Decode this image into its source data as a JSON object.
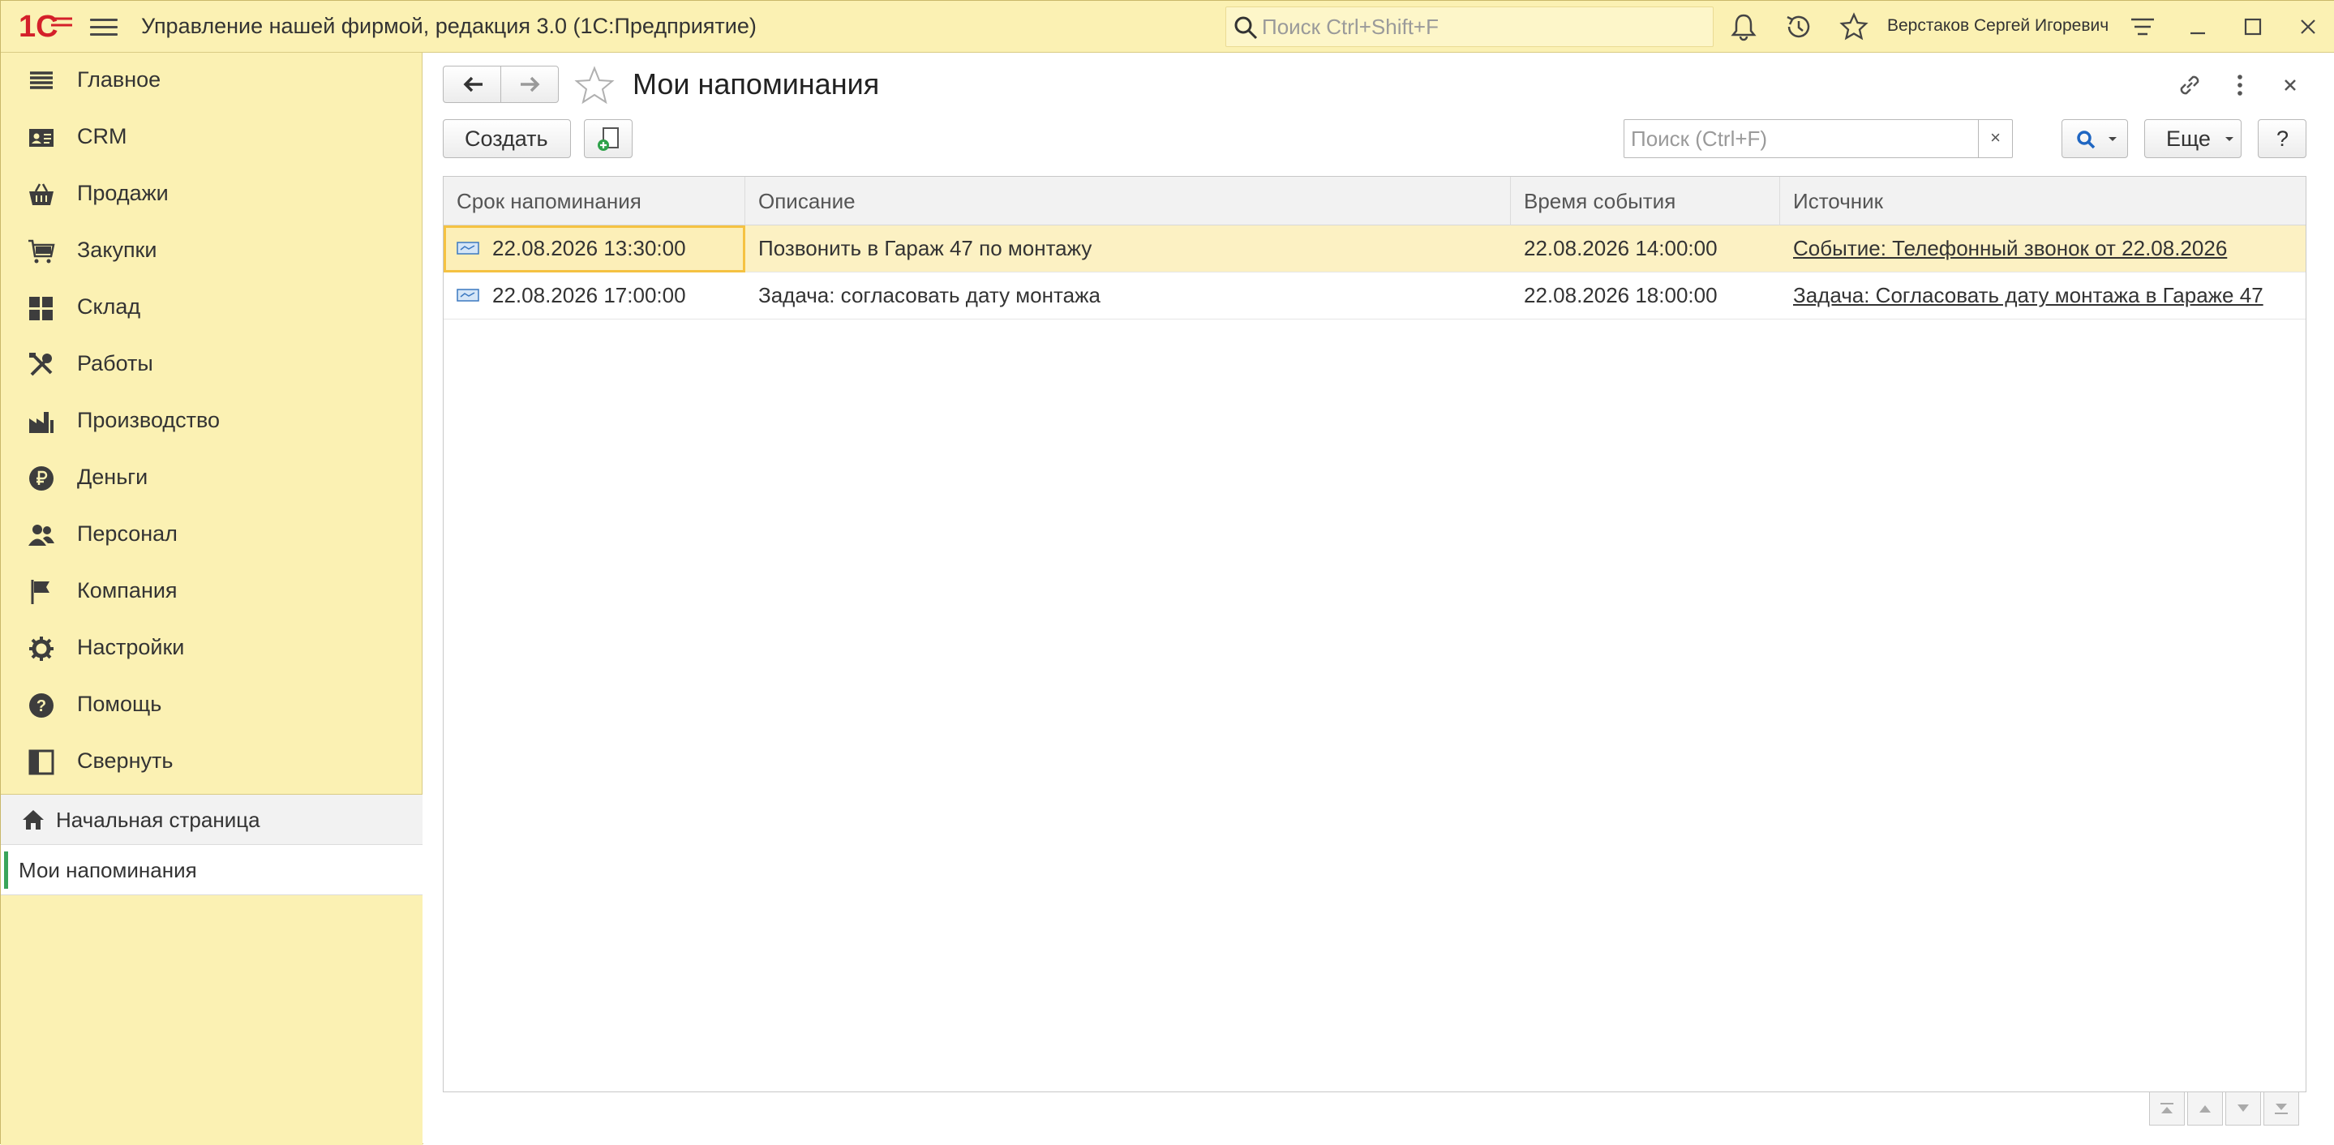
{
  "app": {
    "title": "Управление нашей фирмой, редакция 3.0  (1С:Предприятие)",
    "search_placeholder": "Поиск Ctrl+Shift+F",
    "user": "Верстаков Сергей Игоревич"
  },
  "sidebar": {
    "items": [
      {
        "label": "Главное",
        "icon": "menu-list-icon"
      },
      {
        "label": "CRM",
        "icon": "contact-card-icon"
      },
      {
        "label": "Продажи",
        "icon": "shopping-basket-icon"
      },
      {
        "label": "Закупки",
        "icon": "cart-icon"
      },
      {
        "label": "Склад",
        "icon": "warehouse-grid-icon"
      },
      {
        "label": "Работы",
        "icon": "tools-icon"
      },
      {
        "label": "Производство",
        "icon": "factory-icon"
      },
      {
        "label": "Деньги",
        "icon": "ruble-coin-icon"
      },
      {
        "label": "Персонал",
        "icon": "people-icon"
      },
      {
        "label": "Компания",
        "icon": "flag-icon"
      },
      {
        "label": "Настройки",
        "icon": "gear-icon"
      },
      {
        "label": "Помощь",
        "icon": "help-icon"
      },
      {
        "label": "Свернуть",
        "icon": "collapse-panel-icon"
      }
    ],
    "open_windows": {
      "home": "Начальная страница",
      "current": "Мои напоминания"
    }
  },
  "form": {
    "title": "Мои напоминания",
    "create_label": "Создать",
    "search_placeholder": "Поиск (Ctrl+F)",
    "clear_label": "×",
    "more_label": "Еще",
    "help_label": "?",
    "columns": [
      "Срок напоминания",
      "Описание",
      "Время события",
      "Источник"
    ],
    "rows": [
      {
        "deadline": "22.08.2026 13:30:00",
        "description": "Позвонить в Гараж 47 по монтажу",
        "event_time": "22.08.2026 14:00:00",
        "source": "Событие: Телефонный звонок от 22.08.2026",
        "selected": true
      },
      {
        "deadline": "22.08.2026 17:00:00",
        "description": "Задача: согласовать дату монтажа",
        "event_time": "22.08.2026 18:00:00",
        "source": "Задача: Согласовать дату монтажа в Гараже 47",
        "selected": false
      }
    ]
  },
  "colors": {
    "panel_yellow": "#fbf1b3",
    "selected_row": "#fcf1c3",
    "focus_border": "#f5c242",
    "accent_green": "#3aa55b",
    "logo_red": "#d4202a"
  }
}
